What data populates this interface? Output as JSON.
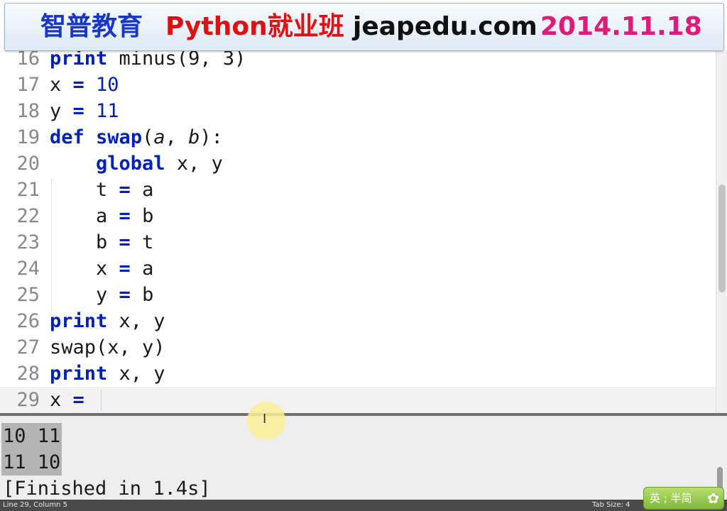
{
  "banner": {
    "org": "智普教育",
    "course": "Python就业班",
    "site": "jeapedu.com",
    "date": "2014.11.18"
  },
  "editor": {
    "lines": [
      {
        "num": "16",
        "tokens": [
          [
            "kw",
            "print"
          ],
          [
            "t",
            " minus(9, 3)"
          ]
        ]
      },
      {
        "num": "17",
        "tokens": [
          [
            "t",
            "x "
          ],
          [
            "op",
            "="
          ],
          [
            "t",
            " "
          ],
          [
            "num",
            "10"
          ]
        ]
      },
      {
        "num": "18",
        "tokens": [
          [
            "t",
            "y "
          ],
          [
            "op",
            "="
          ],
          [
            "t",
            " "
          ],
          [
            "num",
            "11"
          ]
        ]
      },
      {
        "num": "19",
        "tokens": [
          [
            "kw",
            "def"
          ],
          [
            "t",
            " "
          ],
          [
            "fn",
            "swap"
          ],
          [
            "t",
            "("
          ],
          [
            "param",
            "a"
          ],
          [
            "t",
            ", "
          ],
          [
            "param",
            "b"
          ],
          [
            "t",
            "):"
          ]
        ]
      },
      {
        "num": "20",
        "tokens": [
          [
            "t",
            "    "
          ],
          [
            "kw",
            "global"
          ],
          [
            "t",
            " x, y"
          ]
        ]
      },
      {
        "num": "21",
        "tokens": [
          [
            "t",
            "    t "
          ],
          [
            "op",
            "="
          ],
          [
            "t",
            " a"
          ]
        ]
      },
      {
        "num": "22",
        "tokens": [
          [
            "t",
            "    a "
          ],
          [
            "op",
            "="
          ],
          [
            "t",
            " b"
          ]
        ]
      },
      {
        "num": "23",
        "tokens": [
          [
            "t",
            "    b "
          ],
          [
            "op",
            "="
          ],
          [
            "t",
            " t"
          ]
        ]
      },
      {
        "num": "24",
        "tokens": [
          [
            "t",
            "    x "
          ],
          [
            "op",
            "="
          ],
          [
            "t",
            " a"
          ]
        ]
      },
      {
        "num": "25",
        "tokens": [
          [
            "t",
            "    y "
          ],
          [
            "op",
            "="
          ],
          [
            "t",
            " b"
          ]
        ]
      },
      {
        "num": "26",
        "tokens": [
          [
            "kw",
            "print"
          ],
          [
            "t",
            " x, y"
          ]
        ]
      },
      {
        "num": "27",
        "tokens": [
          [
            "t",
            "swap(x, y)"
          ]
        ]
      },
      {
        "num": "28",
        "tokens": [
          [
            "kw",
            "print"
          ],
          [
            "t",
            " x, y"
          ]
        ]
      },
      {
        "num": "29",
        "tokens": [
          [
            "t",
            "x "
          ],
          [
            "op",
            "="
          ]
        ],
        "current": true
      }
    ]
  },
  "output": {
    "lines": [
      {
        "text": "10 11",
        "highlight": true
      },
      {
        "text": "11 10",
        "highlight": true
      },
      {
        "text": "[Finished in 1.4s]",
        "highlight": false
      }
    ]
  },
  "status": {
    "position": "Line 29, Column 5",
    "tab_size": "Tab Size: 4"
  },
  "ime": {
    "label": "英 ; 半简",
    "icon": "flower-icon"
  },
  "cursor": {
    "icon": "ibeam-cursor-icon"
  }
}
